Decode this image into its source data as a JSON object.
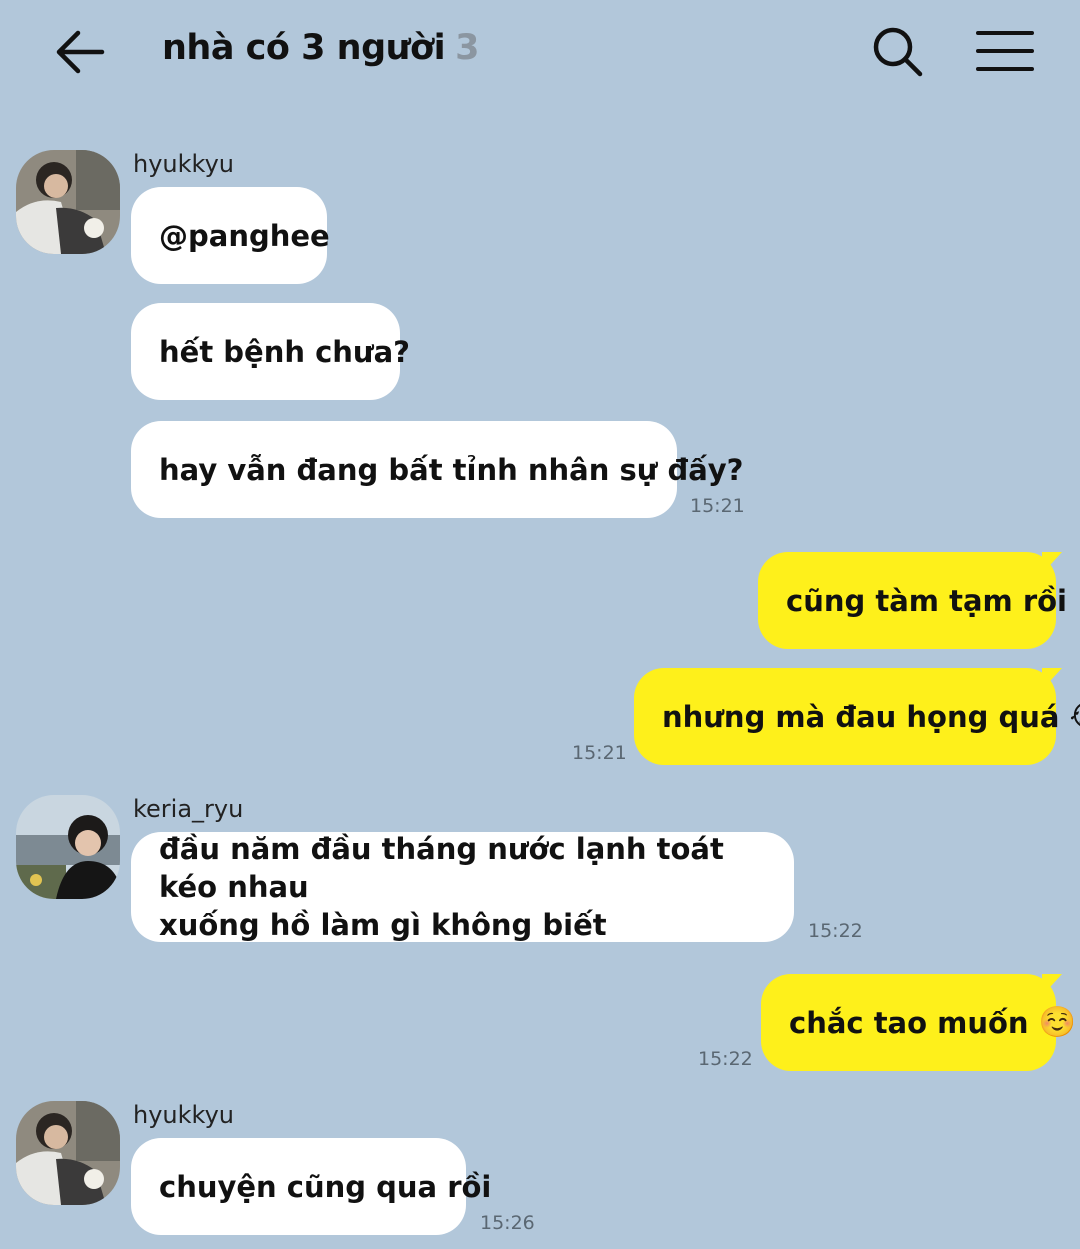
{
  "header": {
    "title": "nhà có 3 người",
    "member_count": "3"
  },
  "messages": [
    {
      "sender": "hyukkyu",
      "text": "@panghee"
    },
    {
      "text": "hết bệnh chưa?"
    },
    {
      "text": "hay vẫn đang bất tỉnh nhân sự đấy?",
      "time": "15:21"
    },
    {
      "text": "cũng tàm tạm rồi"
    },
    {
      "text": "nhưng mà đau họng quá",
      "emoji": "😭",
      "time": "15:21"
    },
    {
      "sender": "keria_ryu",
      "line1": "đầu năm đầu tháng nước lạnh toát kéo nhau",
      "line2": "xuống hồ làm gì không biết",
      "time": "15:22"
    },
    {
      "text": "chắc tao muốn",
      "emoji": "☺️",
      "time": "15:22"
    },
    {
      "sender": "hyukkyu",
      "text": "chuyện cũng qua rồi",
      "time": "15:26"
    }
  ],
  "colors": {
    "background": "#b2c7da",
    "incoming_bubble": "#ffffff",
    "outgoing_bubble": "#fef01b"
  }
}
